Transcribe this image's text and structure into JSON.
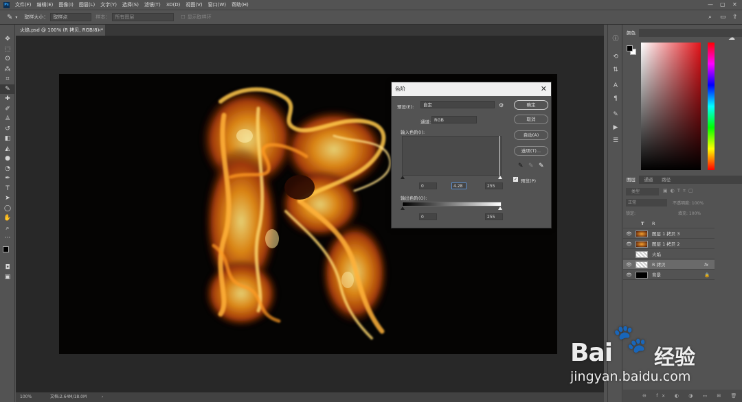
{
  "menubar": {
    "logo": "Ps",
    "items": [
      "文件(F)",
      "编辑(E)",
      "图像(I)",
      "图层(L)",
      "文字(Y)",
      "选择(S)",
      "滤镜(T)",
      "3D(D)",
      "视图(V)",
      "窗口(W)",
      "帮助(H)"
    ]
  },
  "options": {
    "sample_label": "取样大小：",
    "sample_value": "取样点",
    "sample2_label": "样本：",
    "sample2_value": "所有图层",
    "ring_label": "显示取样环"
  },
  "document": {
    "tab_title": "火焰.psd @ 100% (R 拷贝, RGB/8) *",
    "tab_close": "×",
    "zoom": "100%",
    "doc_info": "文档:2.64M/18.0M",
    "status_arrow": "›"
  },
  "panels": {
    "color_tab": "颜色",
    "layer_tabs": [
      "图层",
      "通道",
      "路径"
    ],
    "kind_label": "类型",
    "blend_mode": "正常",
    "opacity": "不透明度: 100%",
    "lock_label": "锁定:",
    "fill": "填充: 100%",
    "layers": [
      {
        "name": "R",
        "type": "text",
        "visible": false
      },
      {
        "name": "图层 1 拷贝 3",
        "type": "image",
        "visible": true
      },
      {
        "name": "图层 1 拷贝 2",
        "type": "image",
        "visible": true
      },
      {
        "name": "火焰",
        "type": "image",
        "visible": false
      },
      {
        "name": "R 拷贝",
        "type": "transparent",
        "visible": true,
        "selected": true,
        "fx": "fx"
      },
      {
        "name": "背景",
        "type": "black",
        "visible": true,
        "locked": true
      }
    ]
  },
  "dialog": {
    "title": "色阶",
    "close": "✕",
    "preset_label": "预设(E):",
    "preset_value": "自定",
    "channel_label": "通道:",
    "channel_value": "RGB",
    "input_label": "输入色阶(I):",
    "input_black": "0",
    "input_gamma": "4.28",
    "input_white": "255",
    "output_label": "输出色阶(O):",
    "output_black": "0",
    "output_white": "255",
    "ok": "确定",
    "cancel": "取消",
    "auto": "自动(A)",
    "options": "选项(T)...",
    "preview_label": "预览(P)",
    "preview_checked": true
  },
  "watermark": {
    "brand_left": "Bai",
    "brand_right": "经验",
    "url": "jingyan.baidu.com"
  },
  "colors": {
    "ui_bg": "#535353",
    "workspace": "#282828",
    "fire_core": "#ffd24a",
    "fire_mid": "#f07a10",
    "fire_dark": "#8a2a04"
  }
}
